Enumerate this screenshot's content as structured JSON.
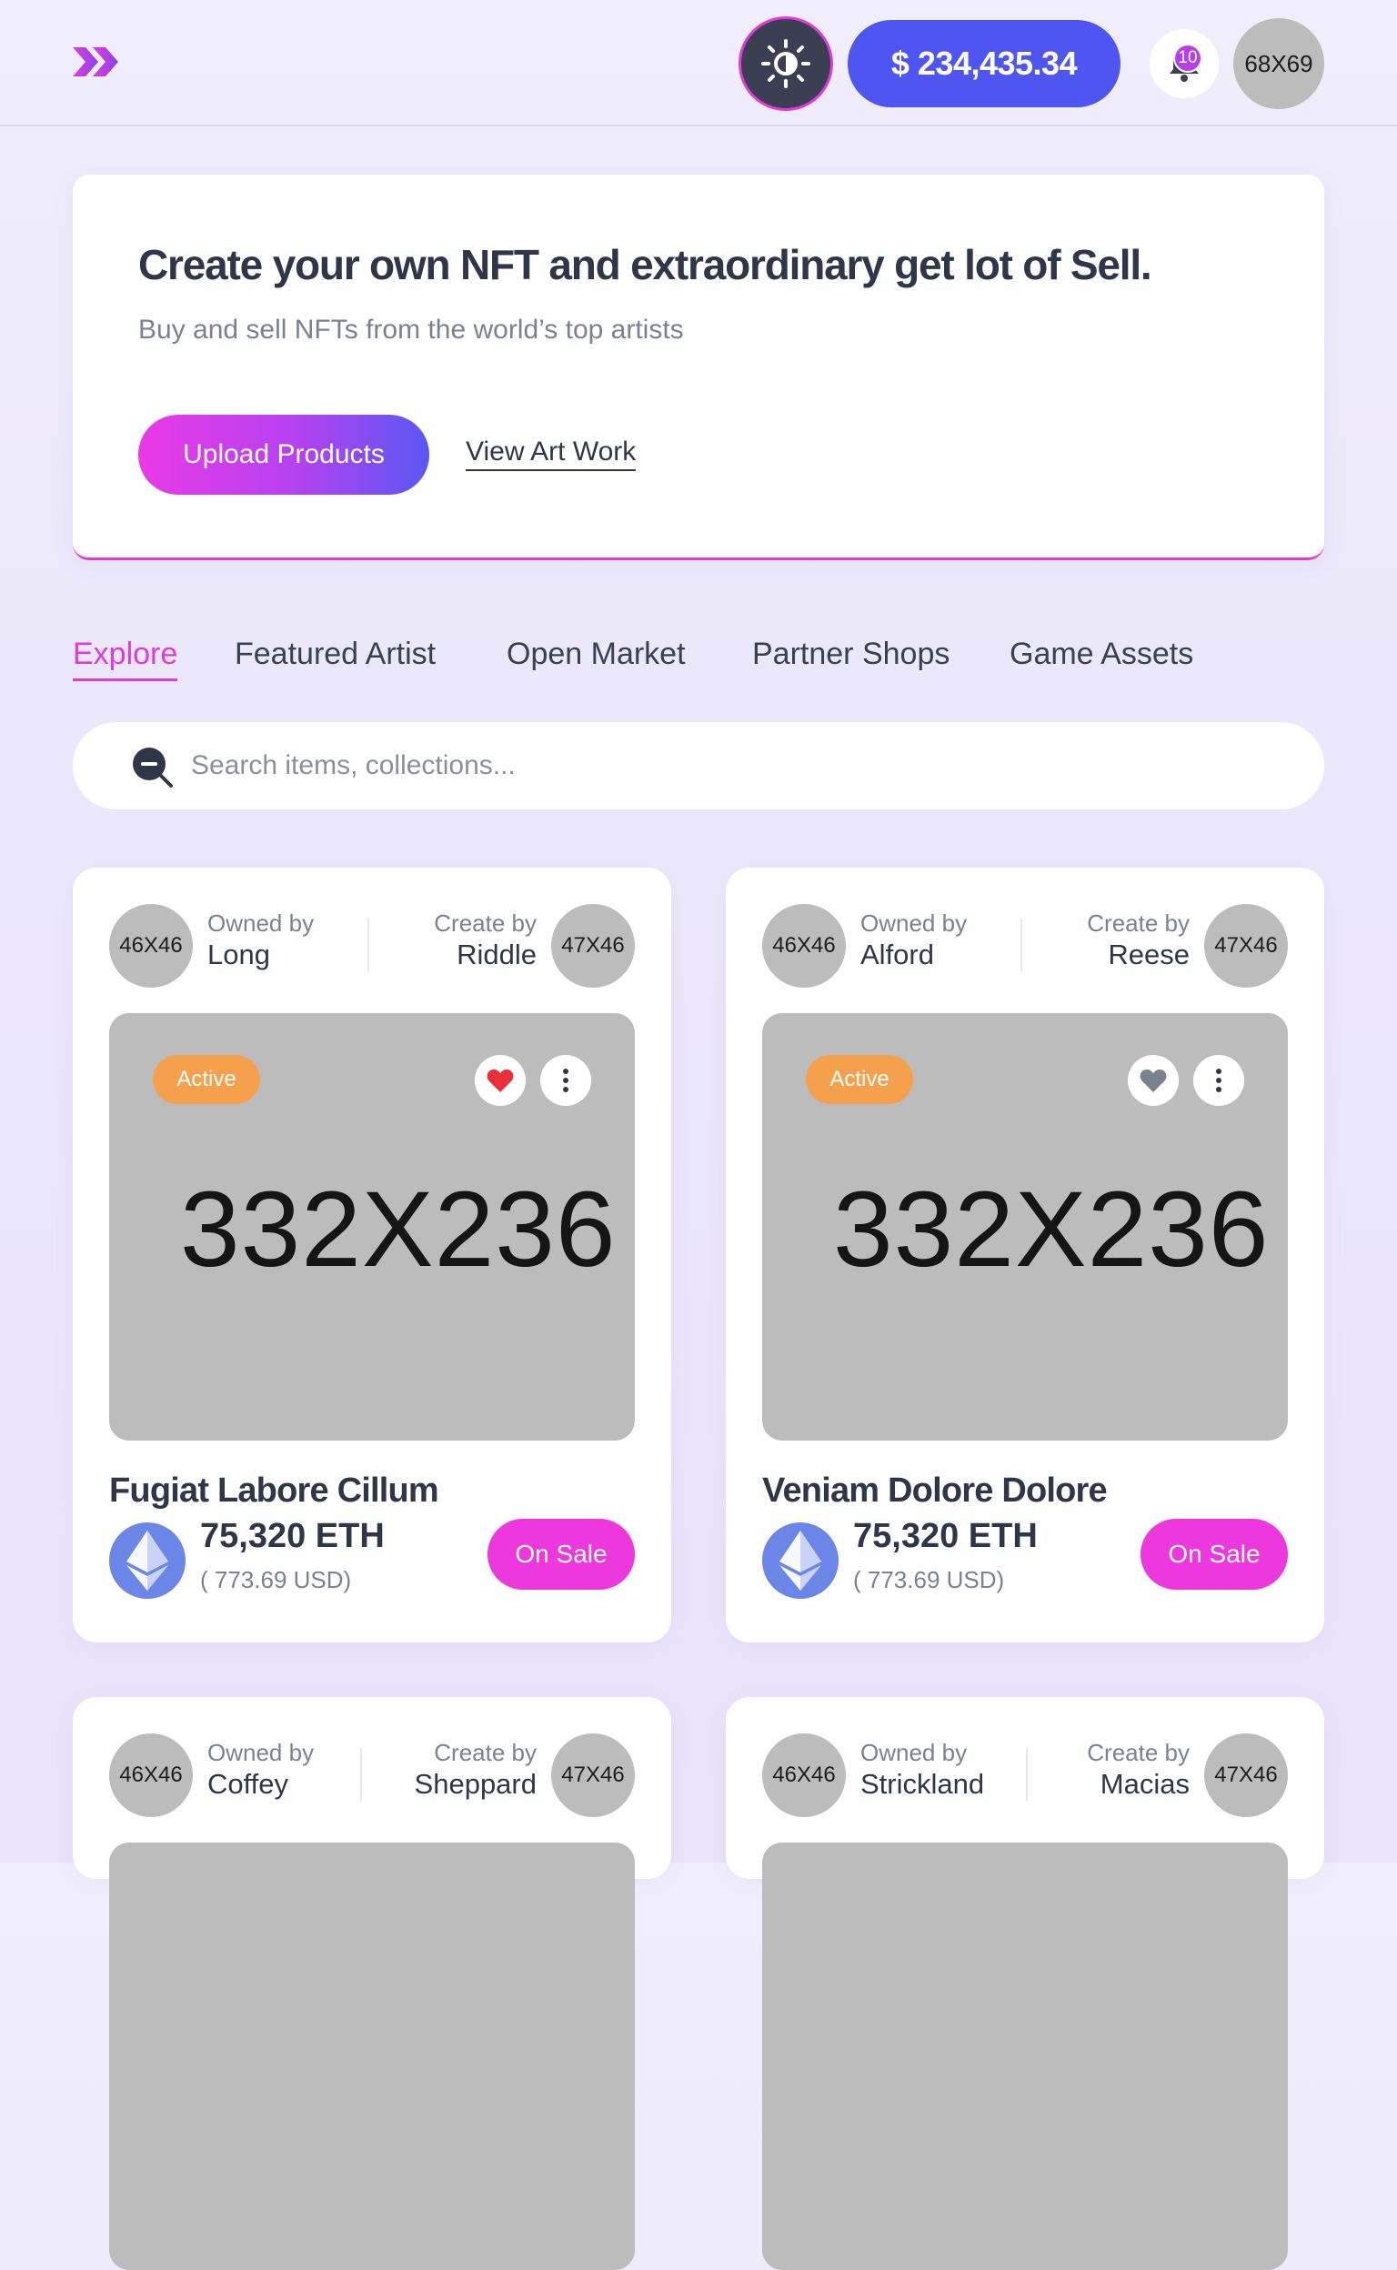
{
  "header": {
    "balance": "$ 234,435.34",
    "notification_count": "10",
    "avatar_label": "68X69"
  },
  "hero": {
    "title": "Create your own NFT and extraordinary get lot of Sell.",
    "subtitle": "Buy and sell NFTs from the world’s top artists",
    "upload_label": "Upload Products",
    "view_label": "View Art Work"
  },
  "tabs": [
    {
      "label": "Explore",
      "active": true
    },
    {
      "label": "Featured Artist",
      "active": false
    },
    {
      "label": "Open Market",
      "active": false
    },
    {
      "label": "Partner Shops",
      "active": false
    },
    {
      "label": "Game Assets",
      "active": false
    }
  ],
  "search": {
    "placeholder": "Search items, collections..."
  },
  "cards": [
    {
      "owner_avatar": "46X46",
      "owner_label": "Owned by",
      "owner_name": "Long",
      "creator_label": "Create by",
      "creator_name": "Riddle",
      "creator_avatar": "47X46",
      "image_label": "332X236",
      "status": "Active",
      "liked": true,
      "title": "Fugiat Labore Cillum",
      "price": "75,320 ETH",
      "usd": "( 773.69 USD)",
      "sale_label": "On Sale"
    },
    {
      "owner_avatar": "46X46",
      "owner_label": "Owned by",
      "owner_name": "Alford",
      "creator_label": "Create by",
      "creator_name": "Reese",
      "creator_avatar": "47X46",
      "image_label": "332X236",
      "status": "Active",
      "liked": false,
      "title": "Veniam Dolore Dolore",
      "price": "75,320 ETH",
      "usd": "( 773.69 USD)",
      "sale_label": "On Sale"
    },
    {
      "owner_avatar": "46X46",
      "owner_label": "Owned by",
      "owner_name": "Coffey",
      "creator_label": "Create by",
      "creator_name": "Sheppard",
      "creator_avatar": "47X46"
    },
    {
      "owner_avatar": "46X46",
      "owner_label": "Owned by",
      "owner_name": "Strickland",
      "creator_label": "Create by",
      "creator_name": "Macias",
      "creator_avatar": "47X46"
    }
  ],
  "colors": {
    "accent": "#e23ad8",
    "primary": "#4e55f0",
    "active_badge": "#f5a04c",
    "heart_liked": "#e8303a",
    "heart_unliked": "#7b8190"
  }
}
